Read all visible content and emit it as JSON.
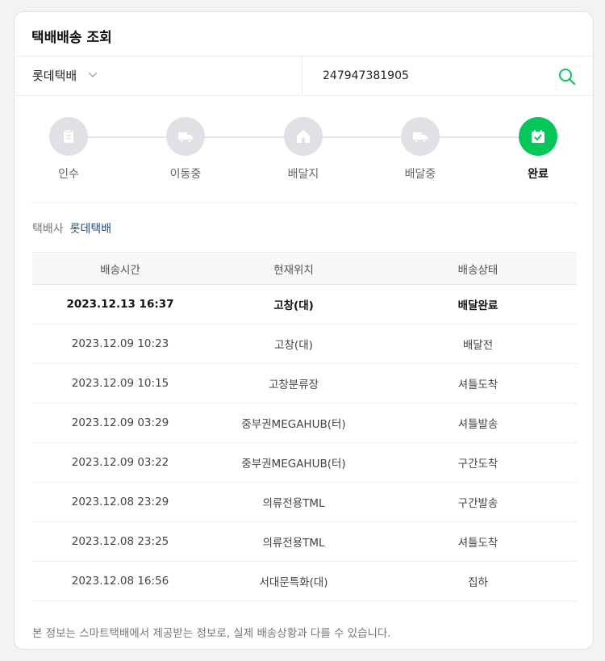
{
  "title": "택배배송 조회",
  "search": {
    "carrier": "롯데택배",
    "tracking_number": "247947381905"
  },
  "steps": [
    {
      "label": "인수",
      "icon": "clipboard-icon",
      "active": false
    },
    {
      "label": "이동중",
      "icon": "truck-icon",
      "active": false
    },
    {
      "label": "배달지",
      "icon": "house-icon",
      "active": false
    },
    {
      "label": "배달중",
      "icon": "delivery-truck-icon",
      "active": false
    },
    {
      "label": "완료",
      "icon": "calendar-check-icon",
      "active": true
    }
  ],
  "company": {
    "label": "택배사",
    "value": "롯데택배"
  },
  "table": {
    "headers": [
      "배송시간",
      "현재위치",
      "배송상태"
    ],
    "rows": [
      {
        "time": "2023.12.13 16:37",
        "location": "고창(대)",
        "status": "배달완료"
      },
      {
        "time": "2023.12.09 10:23",
        "location": "고창(대)",
        "status": "배달전"
      },
      {
        "time": "2023.12.09 10:15",
        "location": "고창분류장",
        "status": "셔틀도착"
      },
      {
        "time": "2023.12.09 03:29",
        "location": "중부권MEGAHUB(터)",
        "status": "셔틀발송"
      },
      {
        "time": "2023.12.09 03:22",
        "location": "중부권MEGAHUB(터)",
        "status": "구간도착"
      },
      {
        "time": "2023.12.08 23:29",
        "location": "의류전용TML",
        "status": "구간발송"
      },
      {
        "time": "2023.12.08 23:25",
        "location": "의류전용TML",
        "status": "셔틀도착"
      },
      {
        "time": "2023.12.08 16:56",
        "location": "서대문특화(대)",
        "status": "집하"
      }
    ]
  },
  "notice": "본 정보는 스마트택배에서 제공받는 정보로, 실제 배송상황과 다를 수 있습니다.",
  "colors": {
    "accent": "#03c75a",
    "link": "#1f4a86",
    "inactive_step": "#dfe1e5"
  }
}
